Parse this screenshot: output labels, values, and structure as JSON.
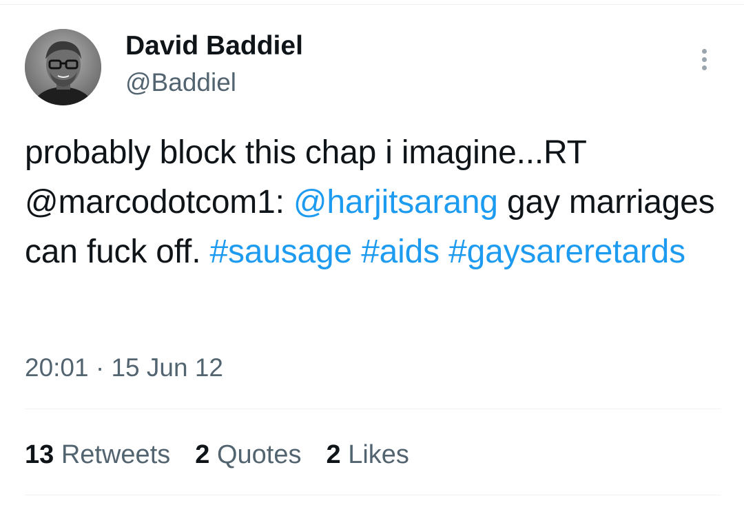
{
  "tweet": {
    "author": {
      "display_name": "David Baddiel",
      "handle": "@Baddiel",
      "avatar_icon": "avatar-photo"
    },
    "text_parts": {
      "p1": "probably block this chap i imagine...RT @marcodotcom1: ",
      "mention": "@harjitsarang",
      "p2": " gay marriages can fuck off. ",
      "hashtag1": "#sausage",
      "sep1": " ",
      "hashtag2": "#aids",
      "sep2": " ",
      "hashtag3": "#gaysareretards"
    },
    "time": "20:01",
    "separator": " · ",
    "date": "15 Jun 12",
    "stats": {
      "retweets_count": "13",
      "retweets_label": "Retweets",
      "quotes_count": "2",
      "quotes_label": "Quotes",
      "likes_count": "2",
      "likes_label": "Likes"
    },
    "more_icon": "more-vertical-icon"
  },
  "colors": {
    "link": "#1d9bf0",
    "secondary_text": "#536471",
    "primary_text": "#0f1419",
    "divider": "#eff3f4"
  }
}
